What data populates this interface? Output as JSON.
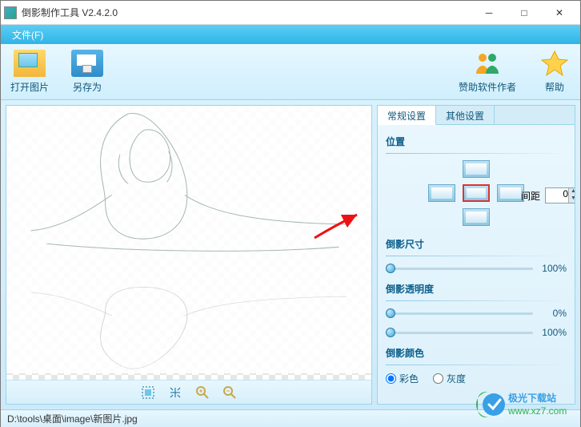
{
  "window": {
    "title": "倒影制作工具 V2.4.2.0"
  },
  "menu": {
    "file": "文件(F)"
  },
  "toolbar": {
    "open": "打开图片",
    "saveas": "另存为",
    "sponsor": "赞助软件作者",
    "help": "帮助"
  },
  "canvas_tools": {
    "fit": "fit-screen",
    "actual": "actual-size",
    "zoom_in": "zoom-in",
    "zoom_out": "zoom-out"
  },
  "panel": {
    "tabs": {
      "general": "常规设置",
      "other": "其他设置"
    },
    "position": {
      "title": "位置",
      "spacing_label": "间距",
      "spacing_value": "0"
    },
    "size": {
      "title": "倒影尺寸",
      "value": "100%"
    },
    "opacity": {
      "title": "倒影透明度",
      "alpha_top": "0%",
      "alpha_bottom": "100%"
    },
    "color": {
      "title": "倒影颜色",
      "color_opt": "彩色",
      "gray_opt": "灰度"
    }
  },
  "status": {
    "path": "D:\\tools\\桌面\\image\\新图片.jpg"
  },
  "watermark": {
    "name": "极光下载站",
    "url": "www.xz7.com"
  }
}
